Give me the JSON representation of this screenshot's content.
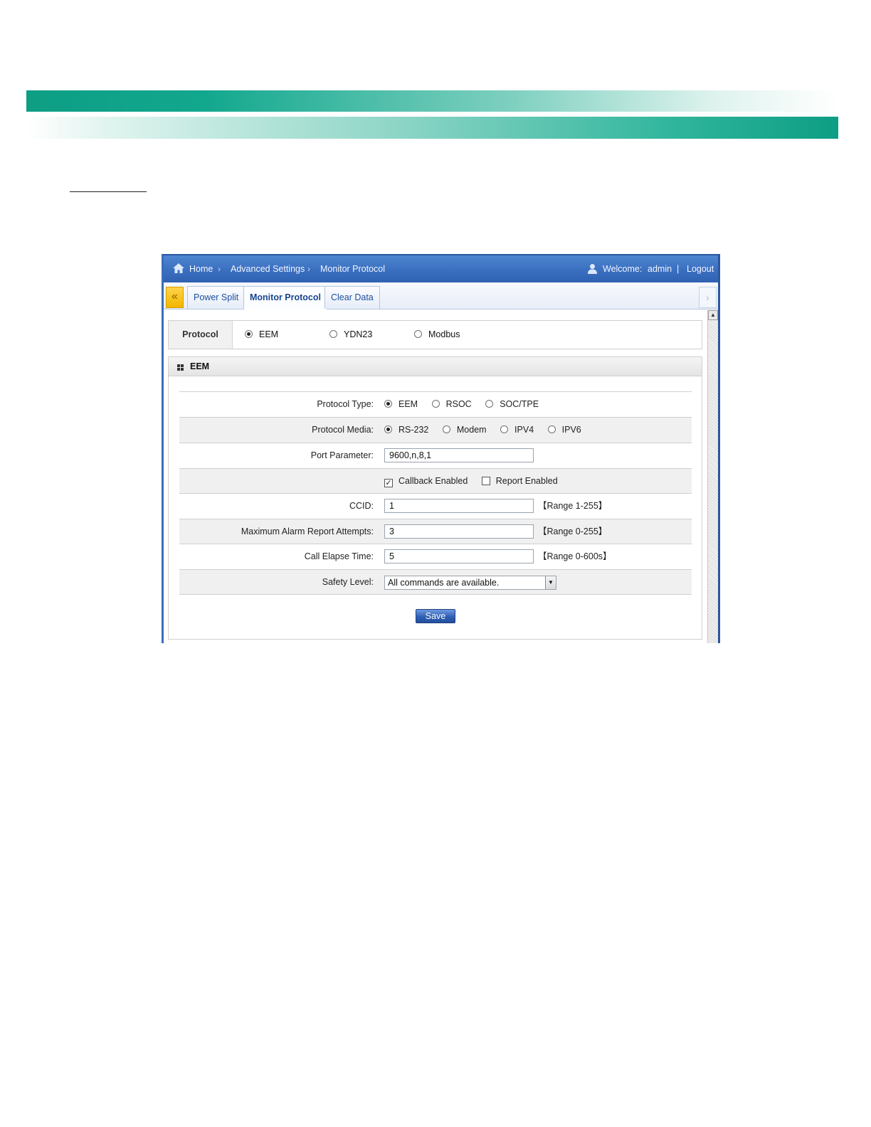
{
  "header": {
    "breadcrumb": [
      "Home",
      "Advanced Settings",
      "Monitor Protocol"
    ],
    "welcome_label": "Welcome:",
    "user": "admin",
    "separator": "|",
    "logout": "Logout",
    "home_icon": "home-icon",
    "user_icon": "user-icon"
  },
  "tabs": [
    {
      "label": "Power Split",
      "active": false
    },
    {
      "label": "Monitor Protocol",
      "active": true
    },
    {
      "label": "Clear Data",
      "active": false
    }
  ],
  "protocol": {
    "label": "Protocol",
    "options": [
      "EEM",
      "YDN23",
      "Modbus"
    ],
    "selected": "EEM"
  },
  "panel": {
    "title": "EEM",
    "protocol_type": {
      "label": "Protocol Type:",
      "options": [
        "EEM",
        "RSOC",
        "SOC/TPE"
      ],
      "selected": "EEM"
    },
    "protocol_media": {
      "label": "Protocol Media:",
      "options": [
        "RS-232",
        "Modem",
        "IPV4",
        "IPV6"
      ],
      "selected": "RS-232"
    },
    "port_parameter": {
      "label": "Port Parameter:",
      "value": "9600,n,8,1"
    },
    "callback_enabled": {
      "label": "Callback Enabled",
      "checked": true
    },
    "report_enabled": {
      "label": "Report Enabled",
      "checked": false
    },
    "ccid": {
      "label": "CCID:",
      "value": "1",
      "range": "【Range 1-255】"
    },
    "max_alarm": {
      "label": "Maximum Alarm Report Attempts:",
      "value": "3",
      "range": "【Range 0-255】"
    },
    "call_elapse": {
      "label": "Call Elapse Time:",
      "value": "5",
      "range": "【Range 0-600s】"
    },
    "safety_level": {
      "label": "Safety Level:",
      "value": "All commands are available."
    },
    "save_label": "Save"
  },
  "colors": {
    "header_blue": "#3a6fc0",
    "band_green": "#0d9e84",
    "button_blue": "#2e5fb4"
  }
}
